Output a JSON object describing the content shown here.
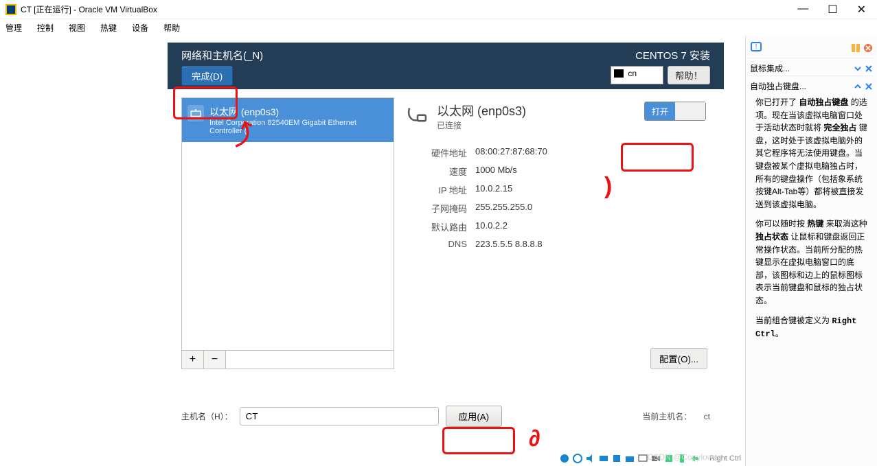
{
  "window": {
    "title": "CT [正在运行] - Oracle VM VirtualBox",
    "controls": {
      "min": "—",
      "max": "☐",
      "close": "✕"
    }
  },
  "menubar": [
    "管理",
    "控制",
    "视图",
    "热键",
    "设备",
    "帮助"
  ],
  "installer": {
    "title": "网络和主机名(_N)",
    "right_title": "CENTOS 7 安装",
    "done": "完成(D)",
    "locale": "cn",
    "help": "帮助！",
    "net_item": {
      "name": "以太网 (enp0s3)",
      "desc": "Intel Corporation 82540EM Gigabit Ethernet Controller ("
    },
    "add": "+",
    "remove": "−",
    "detail": {
      "name": "以太网 (enp0s3)",
      "status": "已连接",
      "toggle_on": "打开",
      "rows": [
        {
          "lbl": "硬件地址",
          "val": "08:00:27:87:68:70"
        },
        {
          "lbl": "速度",
          "val": "1000 Mb/s"
        },
        {
          "lbl": "IP 地址",
          "val": "10.0.2.15"
        },
        {
          "lbl": "子网掩码",
          "val": "255.255.255.0"
        },
        {
          "lbl": "默认路由",
          "val": "10.0.2.2"
        },
        {
          "lbl": "DNS",
          "val": "223.5.5.5 8.8.8.8"
        }
      ],
      "config": "配置(O)..."
    },
    "hostname_label": "主机名（H）：",
    "hostname_value": "CT",
    "apply": "应用(A)",
    "cur_host_label": "当前主机名：",
    "cur_host_value": "ct"
  },
  "side": {
    "mouse_int": "鼠标集成...",
    "kb_title": "自动独占键盘...",
    "p1_a": "你已打开了 ",
    "p1_b": "自动独占键盘",
    "p1_c": " 的选项。现在当该虚拟电脑窗口处于活动状态时就将 ",
    "p1_d": "完全独占",
    "p1_e": " 键盘，这时处于该虚拟电脑外的其它程序将无法使用键盘。当键盘被某个虚拟电脑独占时，所有的键盘操作（包括象系统按键Alt-Tab等）都将被直接发送到该虚拟电脑。",
    "p2_a": "你可以随时按 ",
    "p2_b": "热键",
    "p2_c": " 来取消这种 ",
    "p2_d": "独占状态",
    "p2_e": " 让鼠标和键盘返回正常操作状态。当前所分配的热键显示在虚拟电脑窗口的底部，该图标和边上的鼠标图标表示当前键盘和鼠标的独占状态。",
    "p3_a": "当前组合键被定义为 ",
    "p3_b": "Right Ctrl",
    "p3_c": "。"
  },
  "statusbar": {
    "hostkey_icon": "⌨",
    "hostkey": "Right Ctrl"
  },
  "watermark": "CSDN @Copylower",
  "colors": {
    "accent": "#4a90d9",
    "header": "#243d56",
    "annot": "#e11"
  }
}
